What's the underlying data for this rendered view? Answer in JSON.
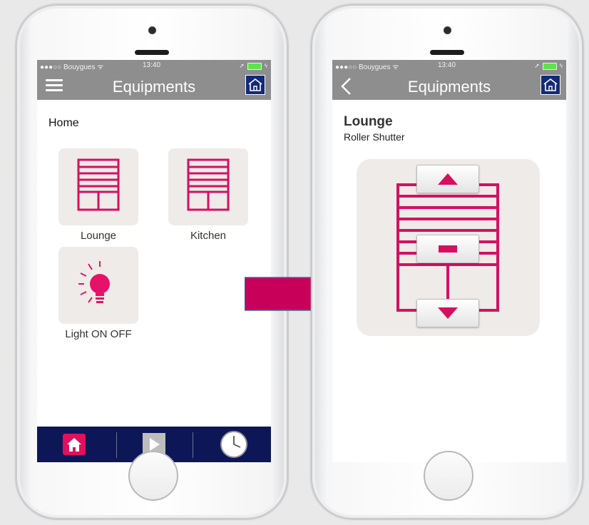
{
  "colors": {
    "accent": "#d6105f",
    "navbar": "#8e8e8e",
    "tabbar": "#0d1757",
    "tile_bg": "#efebe9",
    "arrow": "#c8005a"
  },
  "left_screen": {
    "status": {
      "carrier": "●●●○○ Bouygues ᯤ",
      "time": "13:40"
    },
    "title": "Equipments",
    "section": "Home",
    "tiles": [
      {
        "label": "Lounge",
        "icon": "roller-shutter-icon"
      },
      {
        "label": "Kitchen",
        "icon": "roller-shutter-icon"
      },
      {
        "label": "Light ON OFF",
        "icon": "light-bulb-icon"
      }
    ],
    "tabs": [
      {
        "icon": "home-icon",
        "active": true
      },
      {
        "icon": "play-icon",
        "active": false
      },
      {
        "icon": "clock-icon",
        "active": false
      }
    ]
  },
  "right_screen": {
    "status": {
      "carrier": "●●●○○ Bouygues ᯤ",
      "time": "13:40"
    },
    "title": "Equipments",
    "device_name": "Lounge",
    "device_type": "Roller Shutter",
    "controls": [
      {
        "icon": "triangle-up-icon",
        "action": "up"
      },
      {
        "icon": "stop-bar-icon",
        "action": "stop"
      },
      {
        "icon": "triangle-down-icon",
        "action": "down"
      }
    ]
  }
}
